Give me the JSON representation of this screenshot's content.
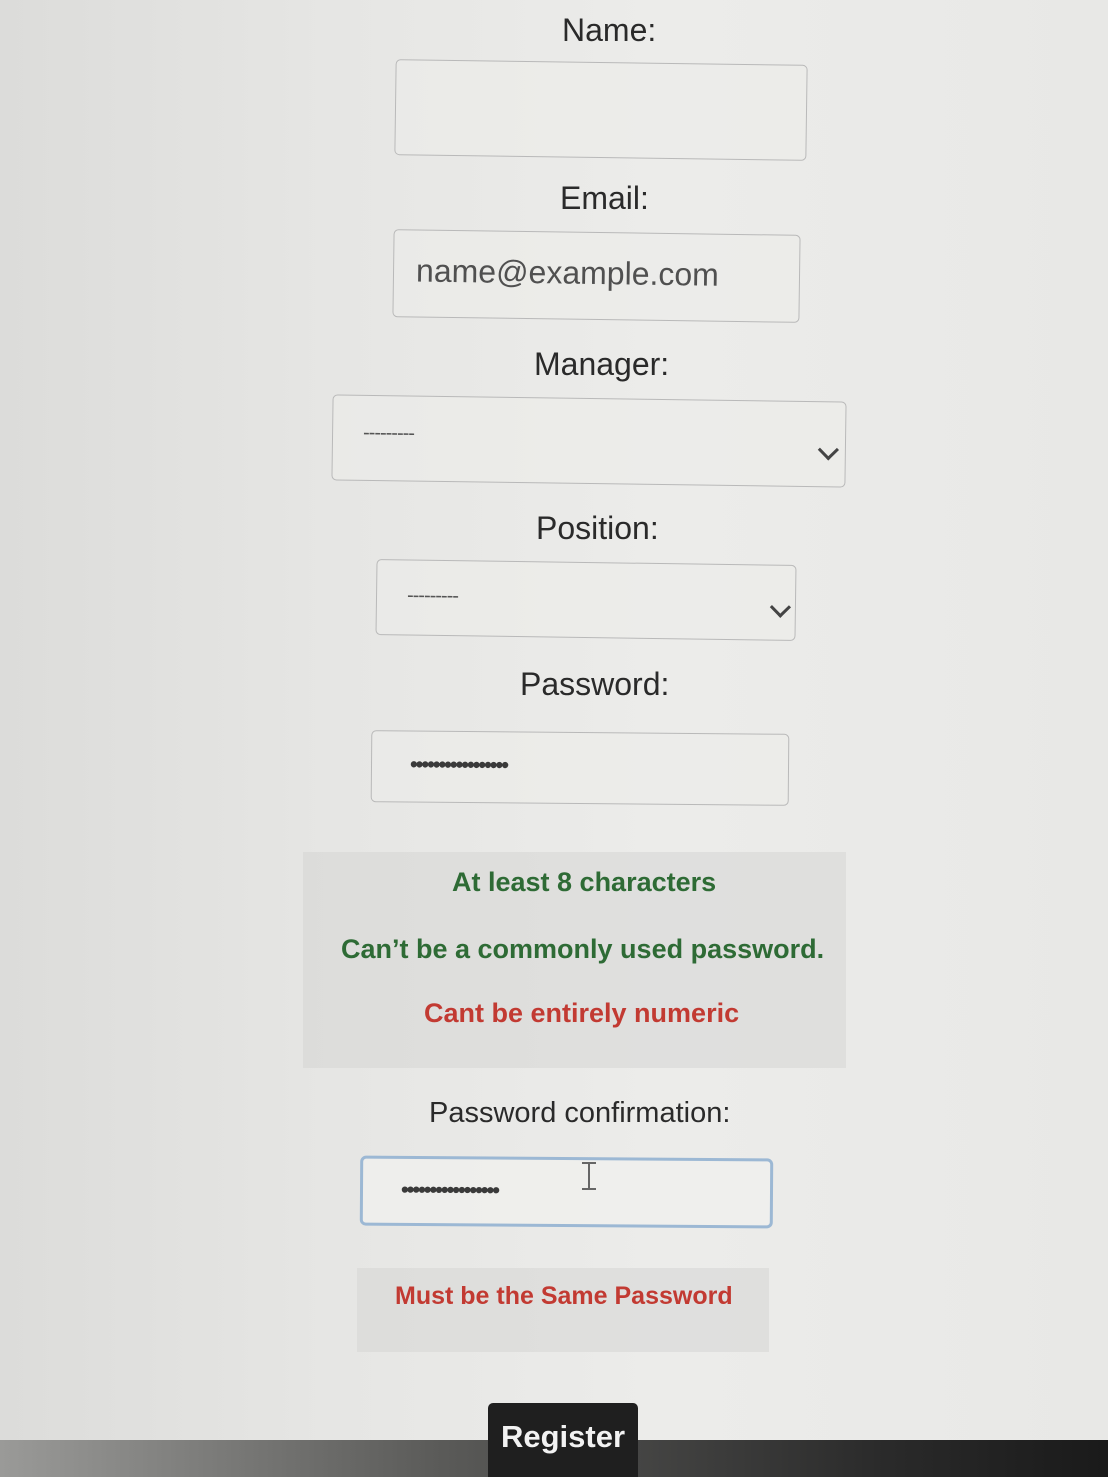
{
  "form": {
    "name": {
      "label": "Name:",
      "value": ""
    },
    "email": {
      "label": "Email:",
      "placeholder": "name@example.com"
    },
    "manager": {
      "label": "Manager:",
      "selected": "---------"
    },
    "position": {
      "label": "Position:",
      "selected": "---------"
    },
    "password": {
      "label": "Password:",
      "masked_value": "•••••••••••••••••"
    },
    "password_rules": [
      {
        "text": "At least 8 characters",
        "status": "ok"
      },
      {
        "text": "Can’t be a commonly used password.",
        "status": "ok"
      },
      {
        "text": "Cant be entirely numeric",
        "status": "error"
      }
    ],
    "password_confirmation": {
      "label": "Password confirmation:",
      "masked_value": "•••••••••••••••••"
    },
    "confirmation_error": "Must be the Same Password",
    "submit_label": "Register"
  },
  "colors": {
    "rule_ok": "#2e6b35",
    "rule_error": "#c23a32",
    "button_bg": "#1f1f1f",
    "focus_border": "#9cb8d4"
  },
  "icons": {
    "select_arrow": "chevron-down-icon",
    "text_cursor": "text-cursor-icon"
  }
}
